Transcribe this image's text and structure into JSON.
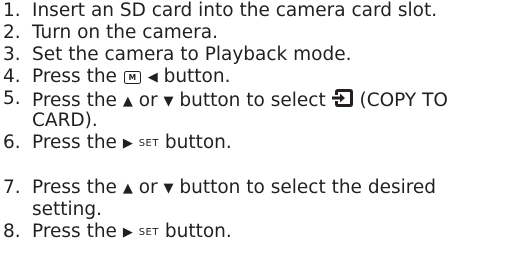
{
  "steps": [
    {
      "num": "1.",
      "text": "Insert an SD card into the camera card slot."
    },
    {
      "num": "2.",
      "text": "Turn on the camera."
    },
    {
      "num": "3.",
      "text": "Set the camera to Playback mode."
    },
    {
      "num": "4.",
      "pre": "Press the ",
      "m_label": "M",
      "post": " button."
    },
    {
      "num": "5.",
      "pre": "Press the ",
      "mid": " or ",
      "mid2": " button to select ",
      "post": " (COPY TO",
      "cont": "CARD)."
    },
    {
      "num": "6.",
      "pre": "Press the ",
      "set_label": "SET",
      "post": " button."
    },
    {
      "num": "7.",
      "pre": "Press the ",
      "mid": " or ",
      "post": " button to select the desired",
      "cont": "setting."
    },
    {
      "num": "8.",
      "pre": "Press the ",
      "set_label": "SET",
      "post": " button."
    }
  ],
  "icons": {
    "up": "up-triangle-icon",
    "down": "down-triangle-icon",
    "left": "left-triangle-icon",
    "right": "right-triangle-icon",
    "menu": "menu-button-icon",
    "copy": "copy-to-card-icon"
  }
}
